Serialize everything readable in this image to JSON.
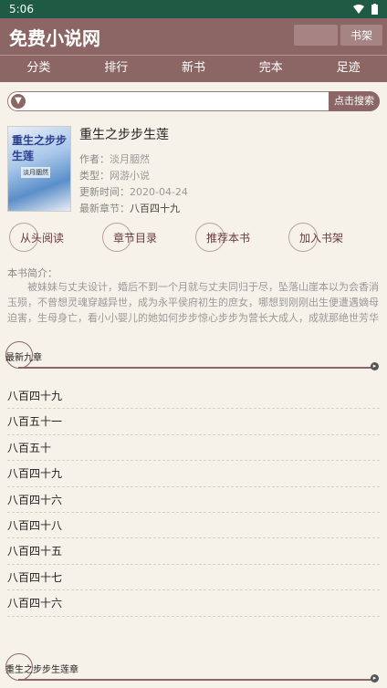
{
  "status": {
    "time": "5:06"
  },
  "header": {
    "title": "免费小说网",
    "shelf_label": "书架"
  },
  "nav": {
    "items": [
      "分类",
      "排行",
      "新书",
      "完本",
      "足迹"
    ]
  },
  "search": {
    "placeholder": "",
    "button_label": "点击搜索"
  },
  "book": {
    "cover_title": "重生之步步生莲",
    "cover_author": "淡月胭然",
    "title": "重生之步步生莲",
    "author_label": "作者：",
    "author": "淡月胭然",
    "type_label": "类型：",
    "type": "网游小说",
    "updated_label": "更新时间：",
    "updated": "2020-04-24",
    "latest_label": "最新章节：",
    "latest": "八百四十九"
  },
  "actions": [
    "从头阅读",
    "章节目录",
    "推荐本书",
    "加入书架"
  ],
  "intro": {
    "label": "本书简介：",
    "text": "被妹妹与丈夫设计，婚后不到一个月就与丈夫同归于尽，坠落山崖本以为会香消玉殒，不曾想灵魂穿越异世，成为永平侯府初生的庶女，哪想到刚刚出生便遭遇嫡母迫害，生母身亡，看小小婴儿的她如何步步惊心步步为营长大成人，成就那绝世芳华"
  },
  "latest_section": {
    "label": "最新九章"
  },
  "chapters": [
    "八百四十九",
    "八百五十一",
    "八百五十",
    "八百四十九",
    "八百四十六",
    "八百四十八",
    "八百四十五",
    "八百四十七",
    "八百四十六"
  ],
  "all_section": {
    "label": "重生之步步生莲章"
  }
}
